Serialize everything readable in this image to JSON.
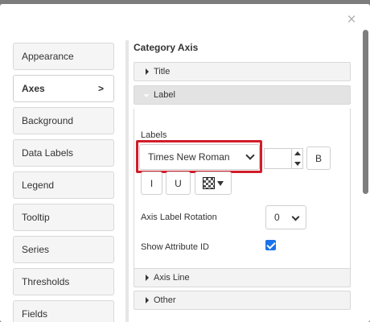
{
  "dialog": {
    "close_glyph": "×"
  },
  "sidebar": {
    "items": [
      {
        "label": "Appearance"
      },
      {
        "label": "Axes",
        "chevron": ">"
      },
      {
        "label": "Background"
      },
      {
        "label": "Data Labels"
      },
      {
        "label": "Legend"
      },
      {
        "label": "Tooltip"
      },
      {
        "label": "Series"
      },
      {
        "label": "Thresholds"
      },
      {
        "label": "Fields"
      }
    ],
    "active_index": 1
  },
  "panel": {
    "title": "Category Axis",
    "sections": [
      {
        "label": "Title",
        "expanded": false
      },
      {
        "label": "Label",
        "expanded": true
      },
      {
        "label": "Axis Line",
        "expanded": false
      },
      {
        "label": "Other",
        "expanded": false
      }
    ]
  },
  "label_settings": {
    "labels_heading": "Labels",
    "font_family": "Times New Roman",
    "font_size": "",
    "bold_label": "B",
    "italic_label": "I",
    "underline_label": "U",
    "color_icon": "checkerboard-color-swatch",
    "rotation_label": "Axis Label Rotation",
    "rotation_value": "0",
    "attribute_id_label": "Show Attribute ID",
    "attribute_id_checked": true
  },
  "colors": {
    "highlight": "#d11d2a",
    "checkbox": "#1a73e8"
  }
}
